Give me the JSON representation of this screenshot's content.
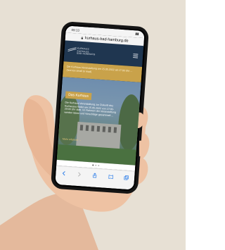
{
  "status_bar": {
    "time": "09:13"
  },
  "browser": {
    "url": "kurhaus-bad-hamburg.de"
  },
  "site": {
    "logo_lines": [
      "KURHAUS",
      "KURHAUS",
      "BAD HOMBURG"
    ]
  },
  "notice": {
    "text": "Die Kurhaus-Veranstaltung am 15.05.2022 ab 17:00 Uhr ... (text too small to read)"
  },
  "hero": {
    "tag": "Das Kurhaus",
    "body": "Die Kurhaus-Veranstaltung zur Zukunft des Kurhauses findet am 15.05.2022 von 17:00-20:00 Uhr statt. Im Rahmen der Veranstaltung werden Ideen und Vorschläge gesammelt ...",
    "link": "Mehr erfahren →"
  },
  "colors": {
    "header": "#1f3650",
    "accent": "#c9a24a",
    "background": "#e7e0d4"
  },
  "icons": {
    "lock": "lock-icon",
    "menu": "menu-icon",
    "back": "back-icon",
    "forward": "forward-icon",
    "share": "share-icon",
    "bookmarks": "bookmarks-icon",
    "tabs": "tabs-icon"
  }
}
